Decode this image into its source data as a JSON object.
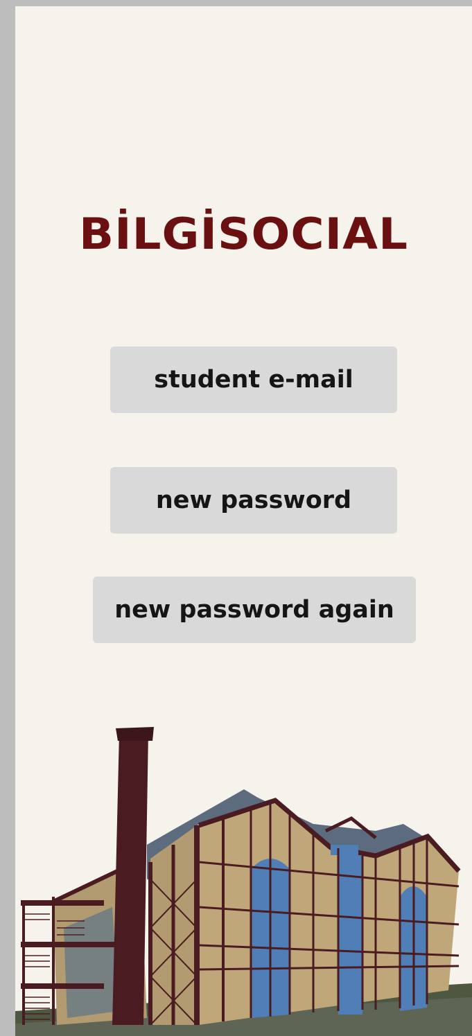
{
  "app": {
    "logo_text": "BİLGİSOCIAL"
  },
  "form": {
    "email_label": "student e-mail",
    "new_password_label": "new password",
    "new_password_again_label": "new password again"
  },
  "colors": {
    "background": "#f6f3ed",
    "logo": "#6b1010",
    "field": "#d9d9d9",
    "frame": "#4a1c22",
    "wall": "#c0a779",
    "glass": "#4f7fb6"
  },
  "icons": {
    "illustration": "factory-building-illustration"
  }
}
